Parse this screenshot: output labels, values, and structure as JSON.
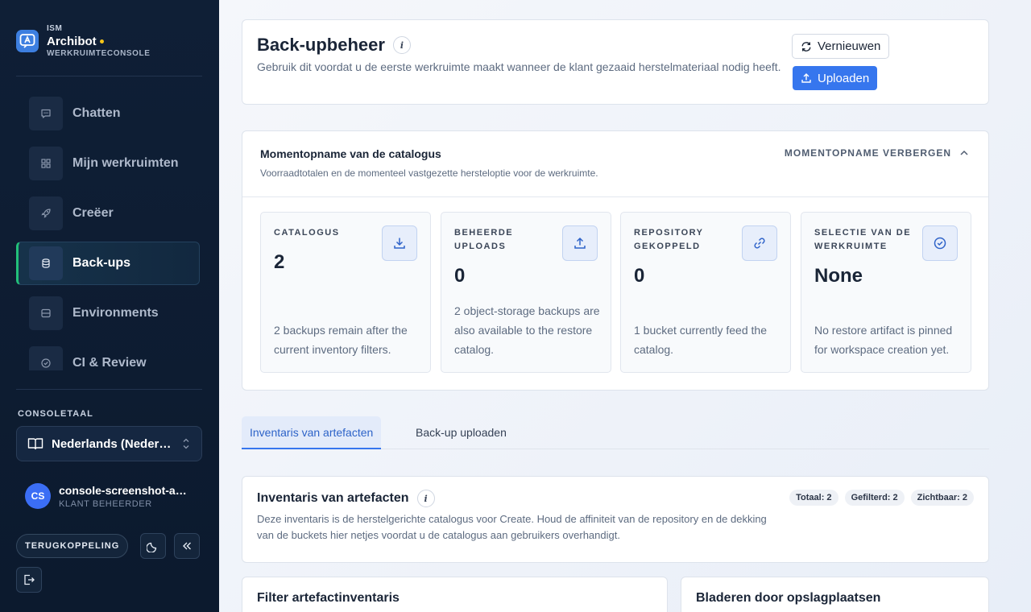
{
  "brand": {
    "small": "ISM",
    "name": "Archibot",
    "subtitle": "WERKRUIMTECONSOLE"
  },
  "sidebar": {
    "items": [
      {
        "label": "Chatten",
        "icon": "chat-icon",
        "active": false
      },
      {
        "label": "Mijn werkruimten",
        "icon": "grid-icon",
        "active": false
      },
      {
        "label": "Creëer",
        "icon": "rocket-icon",
        "active": false
      },
      {
        "label": "Back-ups",
        "icon": "database-icon",
        "active": true
      },
      {
        "label": "Environments",
        "icon": "server-icon",
        "active": false
      },
      {
        "label": "CI & Review",
        "icon": "check-circle-icon",
        "active": false
      }
    ]
  },
  "language": {
    "title": "CONSOLETAAL",
    "selected": "Nederlands (Nederland)"
  },
  "user": {
    "initials": "CS",
    "name": "console-screenshot-admin",
    "role": "KLANT BEHEERDER"
  },
  "footer": {
    "feedback_label": "TERUGKOPPELING"
  },
  "header": {
    "title": "Back-upbeheer",
    "info": "i",
    "description": "Gebruik dit voordat u de eerste werkruimte maakt wanneer de klant gezaaid herstelmateriaal nodig heeft.",
    "refresh_label": "Vernieuwen",
    "upload_label": "Uploaden"
  },
  "snapshot": {
    "title": "Momentopname van de catalogus",
    "subtitle": "Voorraadtotalen en de momenteel vastgezette hersteloptie voor de werkruimte.",
    "toggle_label": "MOMENTOPNAME VERBERGEN",
    "stats": [
      {
        "label": "CATALOGUS",
        "value": "2",
        "description": "2 backups remain after the current inventory filters.",
        "icon": "download-icon"
      },
      {
        "label": "BEHEERDE UPLOADS",
        "value": "0",
        "description": "2 object-storage backups are also available to the restore catalog.",
        "icon": "upload-icon"
      },
      {
        "label": "REPOSITORY GEKOPPELD",
        "value": "0",
        "description": "1 bucket currently feed the catalog.",
        "icon": "link-icon"
      },
      {
        "label": "SELECTIE VAN DE WERKRUIMTE",
        "value": "None",
        "description": "No restore artifact is pinned for workspace creation yet.",
        "icon": "check-circle-icon"
      }
    ]
  },
  "tabs": [
    {
      "label": "Inventaris van artefacten",
      "active": true
    },
    {
      "label": "Back-up uploaden",
      "active": false
    }
  ],
  "inventory": {
    "title": "Inventaris van artefacten",
    "info": "i",
    "description": "Deze inventaris is de herstelgerichte catalogus voor Create. Houd de affiniteit van de repository en de dekking van de buckets hier netjes voordat u de catalogus aan gebruikers overhandigt.",
    "badges": [
      "Totaal: 2",
      "Gefilterd: 2",
      "Zichtbaar: 2"
    ]
  },
  "filter": {
    "title": "Filter artefactinventaris"
  },
  "browse": {
    "title": "Bladeren door opslagplaatsen"
  },
  "colors": {
    "accent": "#3676ee",
    "sidebar_bg": "#0f1f36",
    "active_indicator": "#22c07a",
    "brand_dot": "#f5c518"
  }
}
